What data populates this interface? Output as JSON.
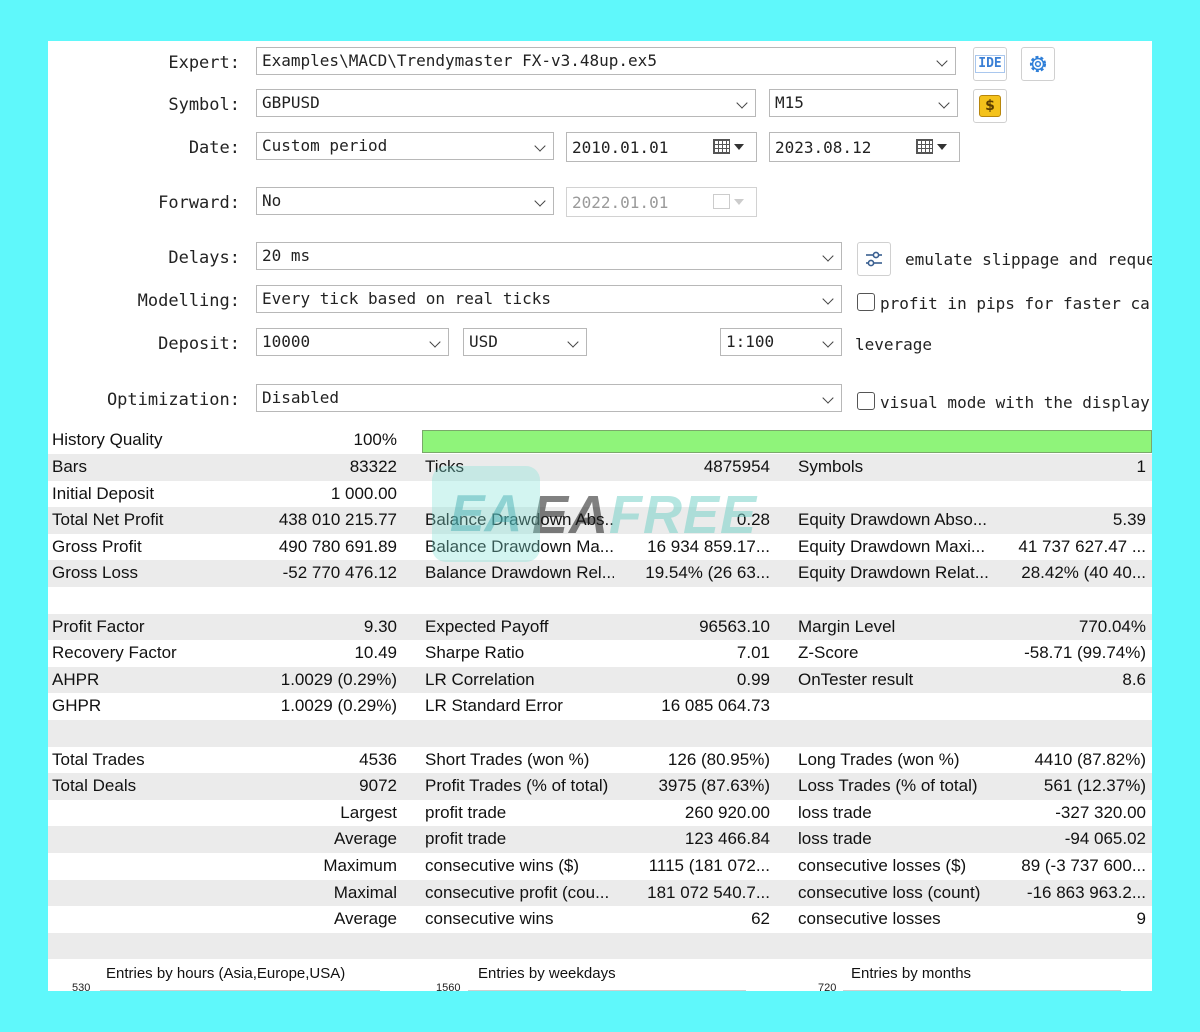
{
  "form": {
    "expert": {
      "label": "Expert:",
      "value": "Examples\\MACD\\Trendymaster FX-v3.48up.ex5",
      "ide_label": "IDE"
    },
    "symbol": {
      "label": "Symbol:",
      "value": "GBPUSD",
      "period": "M15",
      "button_glyph": "$"
    },
    "date": {
      "label": "Date:",
      "mode": "Custom period",
      "from": "2010.01.01",
      "to": "2023.08.12"
    },
    "forward": {
      "label": "Forward:",
      "value": "No",
      "date": "2022.01.01"
    },
    "delays": {
      "label": "Delays:",
      "value": "20 ms",
      "note": "emulate slippage and reque"
    },
    "modelling": {
      "label": "Modelling:",
      "value": "Every tick based on real ticks",
      "note": "profit in pips for faster ca"
    },
    "deposit": {
      "label": "Deposit:",
      "amount": "10000",
      "currency": "USD",
      "leverage_value": "1:100",
      "leverage_label": "leverage"
    },
    "optimization": {
      "label": "Optimization:",
      "value": "Disabled",
      "note": "visual mode with the display"
    }
  },
  "history_quality": {
    "label": "History Quality",
    "value": "100%",
    "fraction": 1.0,
    "bar_color": "#8ff47a"
  },
  "stats": [
    {
      "shade": true,
      "c": [
        [
          "Bars",
          "83322"
        ],
        [
          "Ticks",
          "4875954"
        ],
        [
          "Symbols",
          "1"
        ]
      ]
    },
    {
      "shade": false,
      "c": [
        [
          "Initial Deposit",
          "1 000.00"
        ],
        [
          "",
          ""
        ],
        [
          "",
          ""
        ]
      ]
    },
    {
      "shade": true,
      "c": [
        [
          "Total Net Profit",
          "438 010 215.77"
        ],
        [
          "Balance Drawdown Abs...",
          "0.28"
        ],
        [
          "Equity Drawdown Abso...",
          "5.39"
        ]
      ]
    },
    {
      "shade": false,
      "c": [
        [
          "Gross Profit",
          "490 780 691.89"
        ],
        [
          "Balance Drawdown Ma...",
          "16 934 859.17..."
        ],
        [
          "Equity Drawdown Maxi...",
          "41 737 627.47 ..."
        ]
      ]
    },
    {
      "shade": true,
      "c": [
        [
          "Gross Loss",
          "-52 770 476.12"
        ],
        [
          "Balance Drawdown Rel...",
          "19.54% (26 63..."
        ],
        [
          "Equity Drawdown Relat...",
          "28.42% (40 40..."
        ]
      ]
    },
    {
      "shade": false,
      "c": [
        [
          "",
          ""
        ],
        [
          "",
          ""
        ],
        [
          "",
          ""
        ]
      ]
    },
    {
      "shade": true,
      "c": [
        [
          "Profit Factor",
          "9.30"
        ],
        [
          "Expected Payoff",
          "96563.10"
        ],
        [
          "Margin Level",
          "770.04%"
        ]
      ]
    },
    {
      "shade": false,
      "c": [
        [
          "Recovery Factor",
          "10.49"
        ],
        [
          "Sharpe Ratio",
          "7.01"
        ],
        [
          "Z-Score",
          "-58.71 (99.74%)"
        ]
      ]
    },
    {
      "shade": true,
      "c": [
        [
          "AHPR",
          "1.0029 (0.29%)"
        ],
        [
          "LR Correlation",
          "0.99"
        ],
        [
          "OnTester result",
          "8.6"
        ]
      ]
    },
    {
      "shade": false,
      "c": [
        [
          "GHPR",
          "1.0029 (0.29%)"
        ],
        [
          "LR Standard Error",
          "16 085 064.73"
        ],
        [
          "",
          ""
        ]
      ]
    },
    {
      "shade": true,
      "c": [
        [
          "",
          ""
        ],
        [
          "",
          ""
        ],
        [
          "",
          ""
        ]
      ]
    },
    {
      "shade": false,
      "c": [
        [
          "Total Trades",
          "4536"
        ],
        [
          "Short Trades (won %)",
          "126 (80.95%)"
        ],
        [
          "Long Trades (won %)",
          "4410 (87.82%)"
        ]
      ]
    },
    {
      "shade": true,
      "c": [
        [
          "Total Deals",
          "9072"
        ],
        [
          "Profit Trades (% of total)",
          "3975 (87.63%)"
        ],
        [
          "Loss Trades (% of total)",
          "561 (12.37%)"
        ]
      ]
    },
    {
      "shade": false,
      "c": [
        [
          "",
          "Largest"
        ],
        [
          "profit trade",
          "260 920.00"
        ],
        [
          "loss trade",
          "-327 320.00"
        ]
      ]
    },
    {
      "shade": true,
      "c": [
        [
          "",
          "Average"
        ],
        [
          "profit trade",
          "123 466.84"
        ],
        [
          "loss trade",
          "-94 065.02"
        ]
      ]
    },
    {
      "shade": false,
      "c": [
        [
          "",
          "Maximum"
        ],
        [
          "consecutive wins ($)",
          "1115 (181 072..."
        ],
        [
          "consecutive losses ($)",
          "89 (-3 737 600..."
        ]
      ]
    },
    {
      "shade": true,
      "c": [
        [
          "",
          "Maximal"
        ],
        [
          "consecutive profit (cou...",
          "181 072 540.7..."
        ],
        [
          "consecutive loss (count)",
          "-16 863 963.2..."
        ]
      ]
    },
    {
      "shade": false,
      "c": [
        [
          "",
          "Average"
        ],
        [
          "consecutive wins",
          "62"
        ],
        [
          "consecutive losses",
          "9"
        ]
      ]
    },
    {
      "shade": true,
      "c": [
        [
          "",
          ""
        ],
        [
          "",
          ""
        ],
        [
          "",
          ""
        ]
      ]
    }
  ],
  "charts": [
    {
      "title": "Entries by hours (Asia,Europe,USA)",
      "tick": "530"
    },
    {
      "title": "Entries by weekdays",
      "tick": "1560"
    },
    {
      "title": "Entries by months",
      "tick": "720"
    }
  ],
  "watermark": {
    "text_a": "EA",
    "text_b": "FREE",
    "logo": "EA"
  }
}
